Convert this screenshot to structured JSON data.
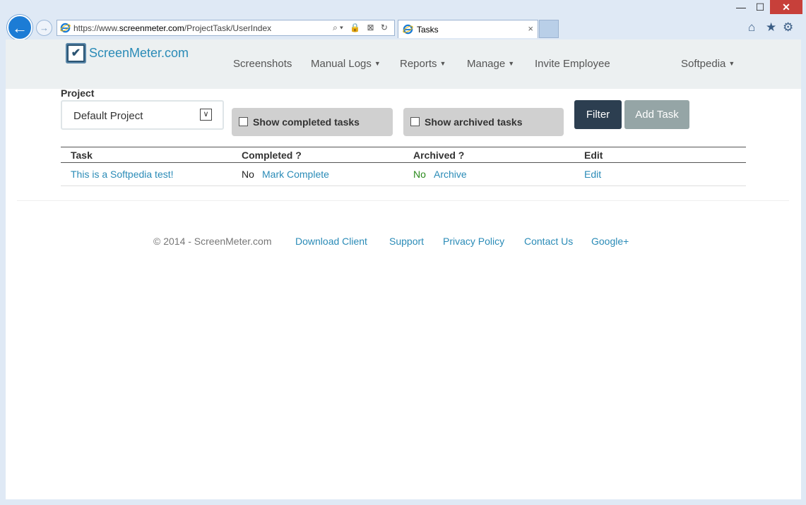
{
  "browser": {
    "url_prefix": "https://www.",
    "url_domain": "screenmeter.com",
    "url_path": "/ProjectTask/UserIndex",
    "tab_title": "Tasks",
    "tab_close": "×",
    "back_glyph": "←",
    "forward_glyph": "→",
    "addr_tools": "⌕▾ 🔒 ⊠ ↻",
    "win_min": "—",
    "win_max": "☐",
    "win_close": "✕",
    "home_glyph": "⌂",
    "star_glyph": "★",
    "gear_glyph": "⚙"
  },
  "navbar": {
    "logo_text": "ScreenMeter.com",
    "logo_check": "✔",
    "items": [
      {
        "label": "Screenshots",
        "dropdown": false
      },
      {
        "label": "Manual Logs",
        "dropdown": true
      },
      {
        "label": "Reports",
        "dropdown": true
      },
      {
        "label": "Manage",
        "dropdown": true
      },
      {
        "label": "Invite Employee",
        "dropdown": false
      }
    ],
    "user_label": "Softpedia",
    "caret": "▼"
  },
  "filters": {
    "project_label": "Project",
    "project_value": "Default Project",
    "select_arrow": "∨",
    "show_completed_label": "Show completed tasks",
    "show_archived_label": "Show archived tasks",
    "filter_button": "Filter",
    "add_task_button": "Add Task"
  },
  "table": {
    "headers": [
      "Task",
      "Completed ?",
      "Archived ?",
      "Edit"
    ],
    "rows": [
      {
        "task": "This is a Softpedia test!",
        "completed": "No",
        "mark_complete": "Mark Complete",
        "archived": "No",
        "archive": "Archive",
        "edit": "Edit"
      }
    ]
  },
  "footer": {
    "copyright": "© 2014 - ScreenMeter.com",
    "links": [
      "Download Client",
      "Support",
      "Privacy Policy",
      "Contact Us",
      "Google+"
    ]
  },
  "colors": {
    "accent": "#2a8bb7",
    "filter_button": "#2c3e50",
    "add_task_button": "#95a5a6",
    "navbar_bg": "#ecf0f1",
    "no_archived": "#2a8a1c"
  }
}
